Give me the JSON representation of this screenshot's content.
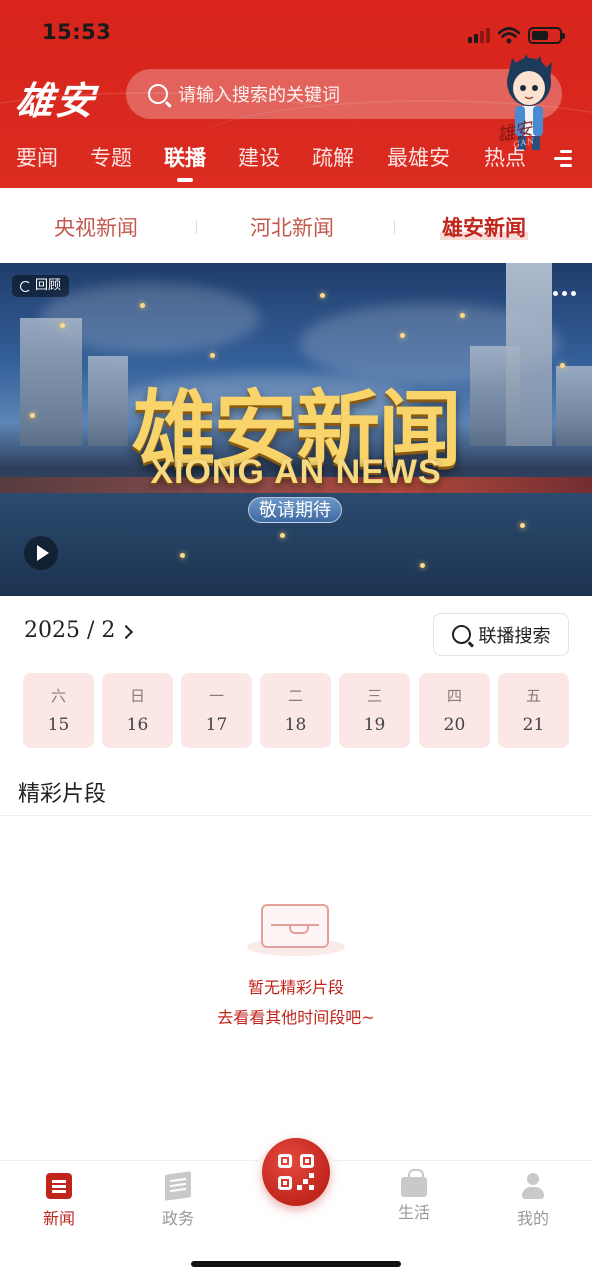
{
  "status_bar": {
    "time": "15:53"
  },
  "header": {
    "logo": "雄安",
    "search_placeholder": "请输入搜索的关键词",
    "mascot_tag": "雄安",
    "mascot_tag_sub": "GAN"
  },
  "nav": {
    "items": [
      {
        "label": "要闻"
      },
      {
        "label": "专题"
      },
      {
        "label": "联播",
        "active": true
      },
      {
        "label": "建设"
      },
      {
        "label": "疏解"
      },
      {
        "label": "最雄安"
      },
      {
        "label": "热点"
      }
    ]
  },
  "subtabs": [
    {
      "label": "央视新闻"
    },
    {
      "label": "河北新闻"
    },
    {
      "label": "雄安新闻",
      "active": true
    }
  ],
  "video": {
    "badge": "回顾",
    "title_cn": "雄安新闻",
    "title_en": "XIONG AN NEWS",
    "tagline": "敬请期待"
  },
  "schedule": {
    "month_label": "2025 / 2",
    "search_button": "联播搜索",
    "days": [
      {
        "weekday": "六",
        "date": "15"
      },
      {
        "weekday": "日",
        "date": "16"
      },
      {
        "weekday": "一",
        "date": "17"
      },
      {
        "weekday": "二",
        "date": "18"
      },
      {
        "weekday": "三",
        "date": "19"
      },
      {
        "weekday": "四",
        "date": "20"
      },
      {
        "weekday": "五",
        "date": "21"
      }
    ]
  },
  "highlights": {
    "title": "精彩片段",
    "empty_line1": "暂无精彩片段",
    "empty_line2": "去看看其他时间段吧~"
  },
  "tabbar": {
    "items": [
      {
        "label": "新闻",
        "icon": "news-icon",
        "active": true
      },
      {
        "label": "政务",
        "icon": "government-icon"
      },
      {
        "label": "生活",
        "icon": "life-icon"
      },
      {
        "label": "我的",
        "icon": "profile-icon"
      }
    ],
    "center_icon": "qr-code-icon"
  },
  "colors": {
    "brand_red": "#d8241c",
    "accent_text": "#c0251c",
    "day_chip_bg": "#fbe7e6"
  }
}
